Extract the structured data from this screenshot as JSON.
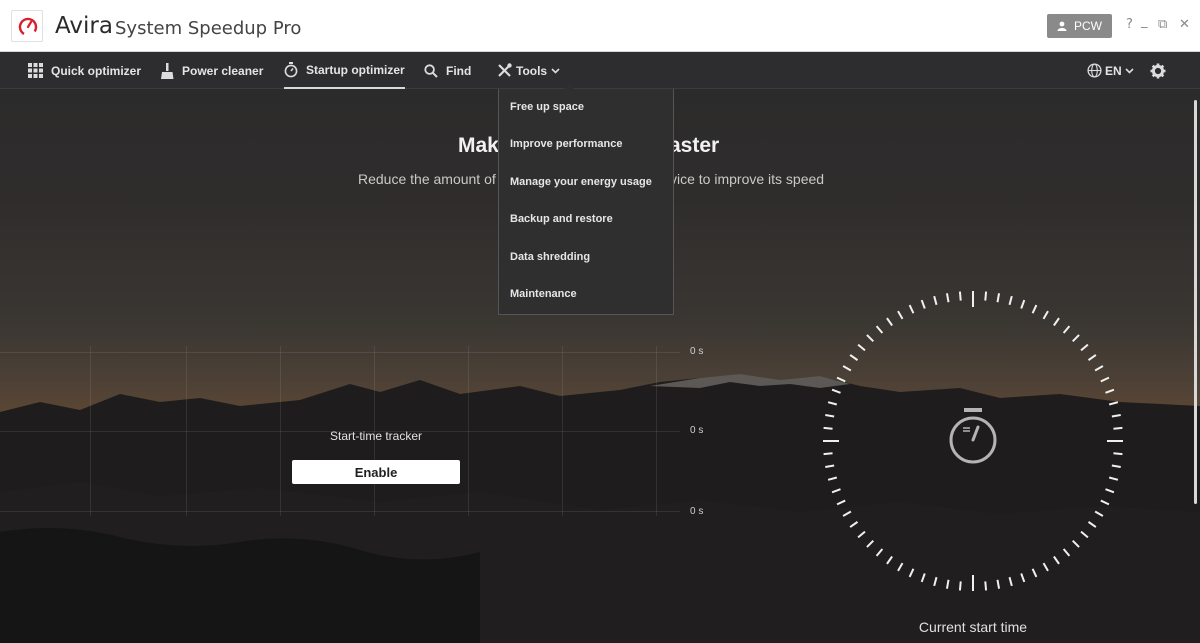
{
  "window": {
    "brand": "Avira",
    "product": "System Speedup Pro",
    "user_button": "PCW",
    "controls": {
      "help": "?",
      "minimize": "_",
      "restore": "⧉",
      "close": "✕"
    }
  },
  "nav": {
    "items": [
      {
        "label": "Quick optimizer",
        "icon": "grid-icon"
      },
      {
        "label": "Power cleaner",
        "icon": "broom-icon"
      },
      {
        "label": "Startup optimizer",
        "icon": "stopwatch-icon",
        "active": true
      },
      {
        "label": "Find",
        "icon": "search-icon"
      },
      {
        "label": "Tools",
        "icon": "tools-icon"
      }
    ],
    "language": "EN"
  },
  "tools_menu": {
    "items": [
      "Free up space",
      "Improve performance",
      "Manage your energy usage",
      "Backup and restore",
      "Data shredding",
      "Maintenance"
    ]
  },
  "content": {
    "heading_left": "Mak",
    "heading_right": "faster",
    "subheading_left": "Reduce the amount of",
    "subheading_right": "vice to improve its speed",
    "y_labels": [
      "0 s",
      "0 s",
      "0 s"
    ],
    "tracker_label": "Start-time tracker",
    "enable_button": "Enable",
    "current_start_time_label": "Current start time"
  },
  "colors": {
    "logo_red": "#d8202a",
    "background_dark": "#2b2b2d",
    "menu_bg": "#2f2f30",
    "user_button_bg": "#8a8a8a"
  }
}
